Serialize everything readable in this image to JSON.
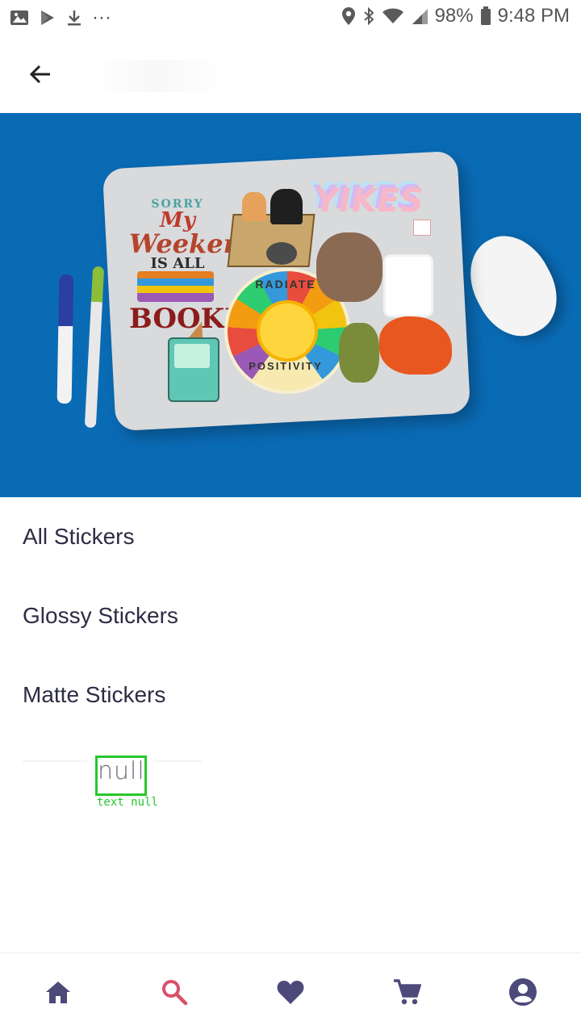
{
  "status_bar": {
    "battery": "98%",
    "time": "9:48 PM",
    "overflow": "···",
    "icons": [
      "image-icon",
      "play-store-icon",
      "download-icon",
      "location-icon",
      "bluetooth-icon",
      "wifi-icon",
      "signal-icon",
      "battery-icon"
    ]
  },
  "app_bar": {
    "back_icon": "arrow-left-icon"
  },
  "hero": {
    "sticker_text": {
      "sorry": "SORRY",
      "my": "My",
      "weekend": "Weekend",
      "is_all": "IS ALL",
      "booked": "BOOKED",
      "yikes": "YIKES",
      "radiate": "RADIATE",
      "positivity": "POSITIVITY"
    }
  },
  "menu": {
    "items": [
      {
        "label": "All Stickers"
      },
      {
        "label": "Glossy Stickers"
      },
      {
        "label": "Matte Stickers"
      }
    ],
    "null_item": {
      "label": "null",
      "caption": "text null"
    }
  },
  "bottom_nav": {
    "items": [
      {
        "icon": "home-icon",
        "color": "#4d4a7a"
      },
      {
        "icon": "search-icon",
        "color": "#d9506b",
        "active": true
      },
      {
        "icon": "heart-icon",
        "color": "#4d4a7a"
      },
      {
        "icon": "cart-icon",
        "color": "#4d4a7a"
      },
      {
        "icon": "account-icon",
        "color": "#4d4a7a"
      }
    ]
  },
  "colors": {
    "hero_background": "#0a6bb5",
    "nav_default": "#4d4a7a",
    "nav_active": "#d9506b",
    "debug_box": "#27c72b"
  }
}
